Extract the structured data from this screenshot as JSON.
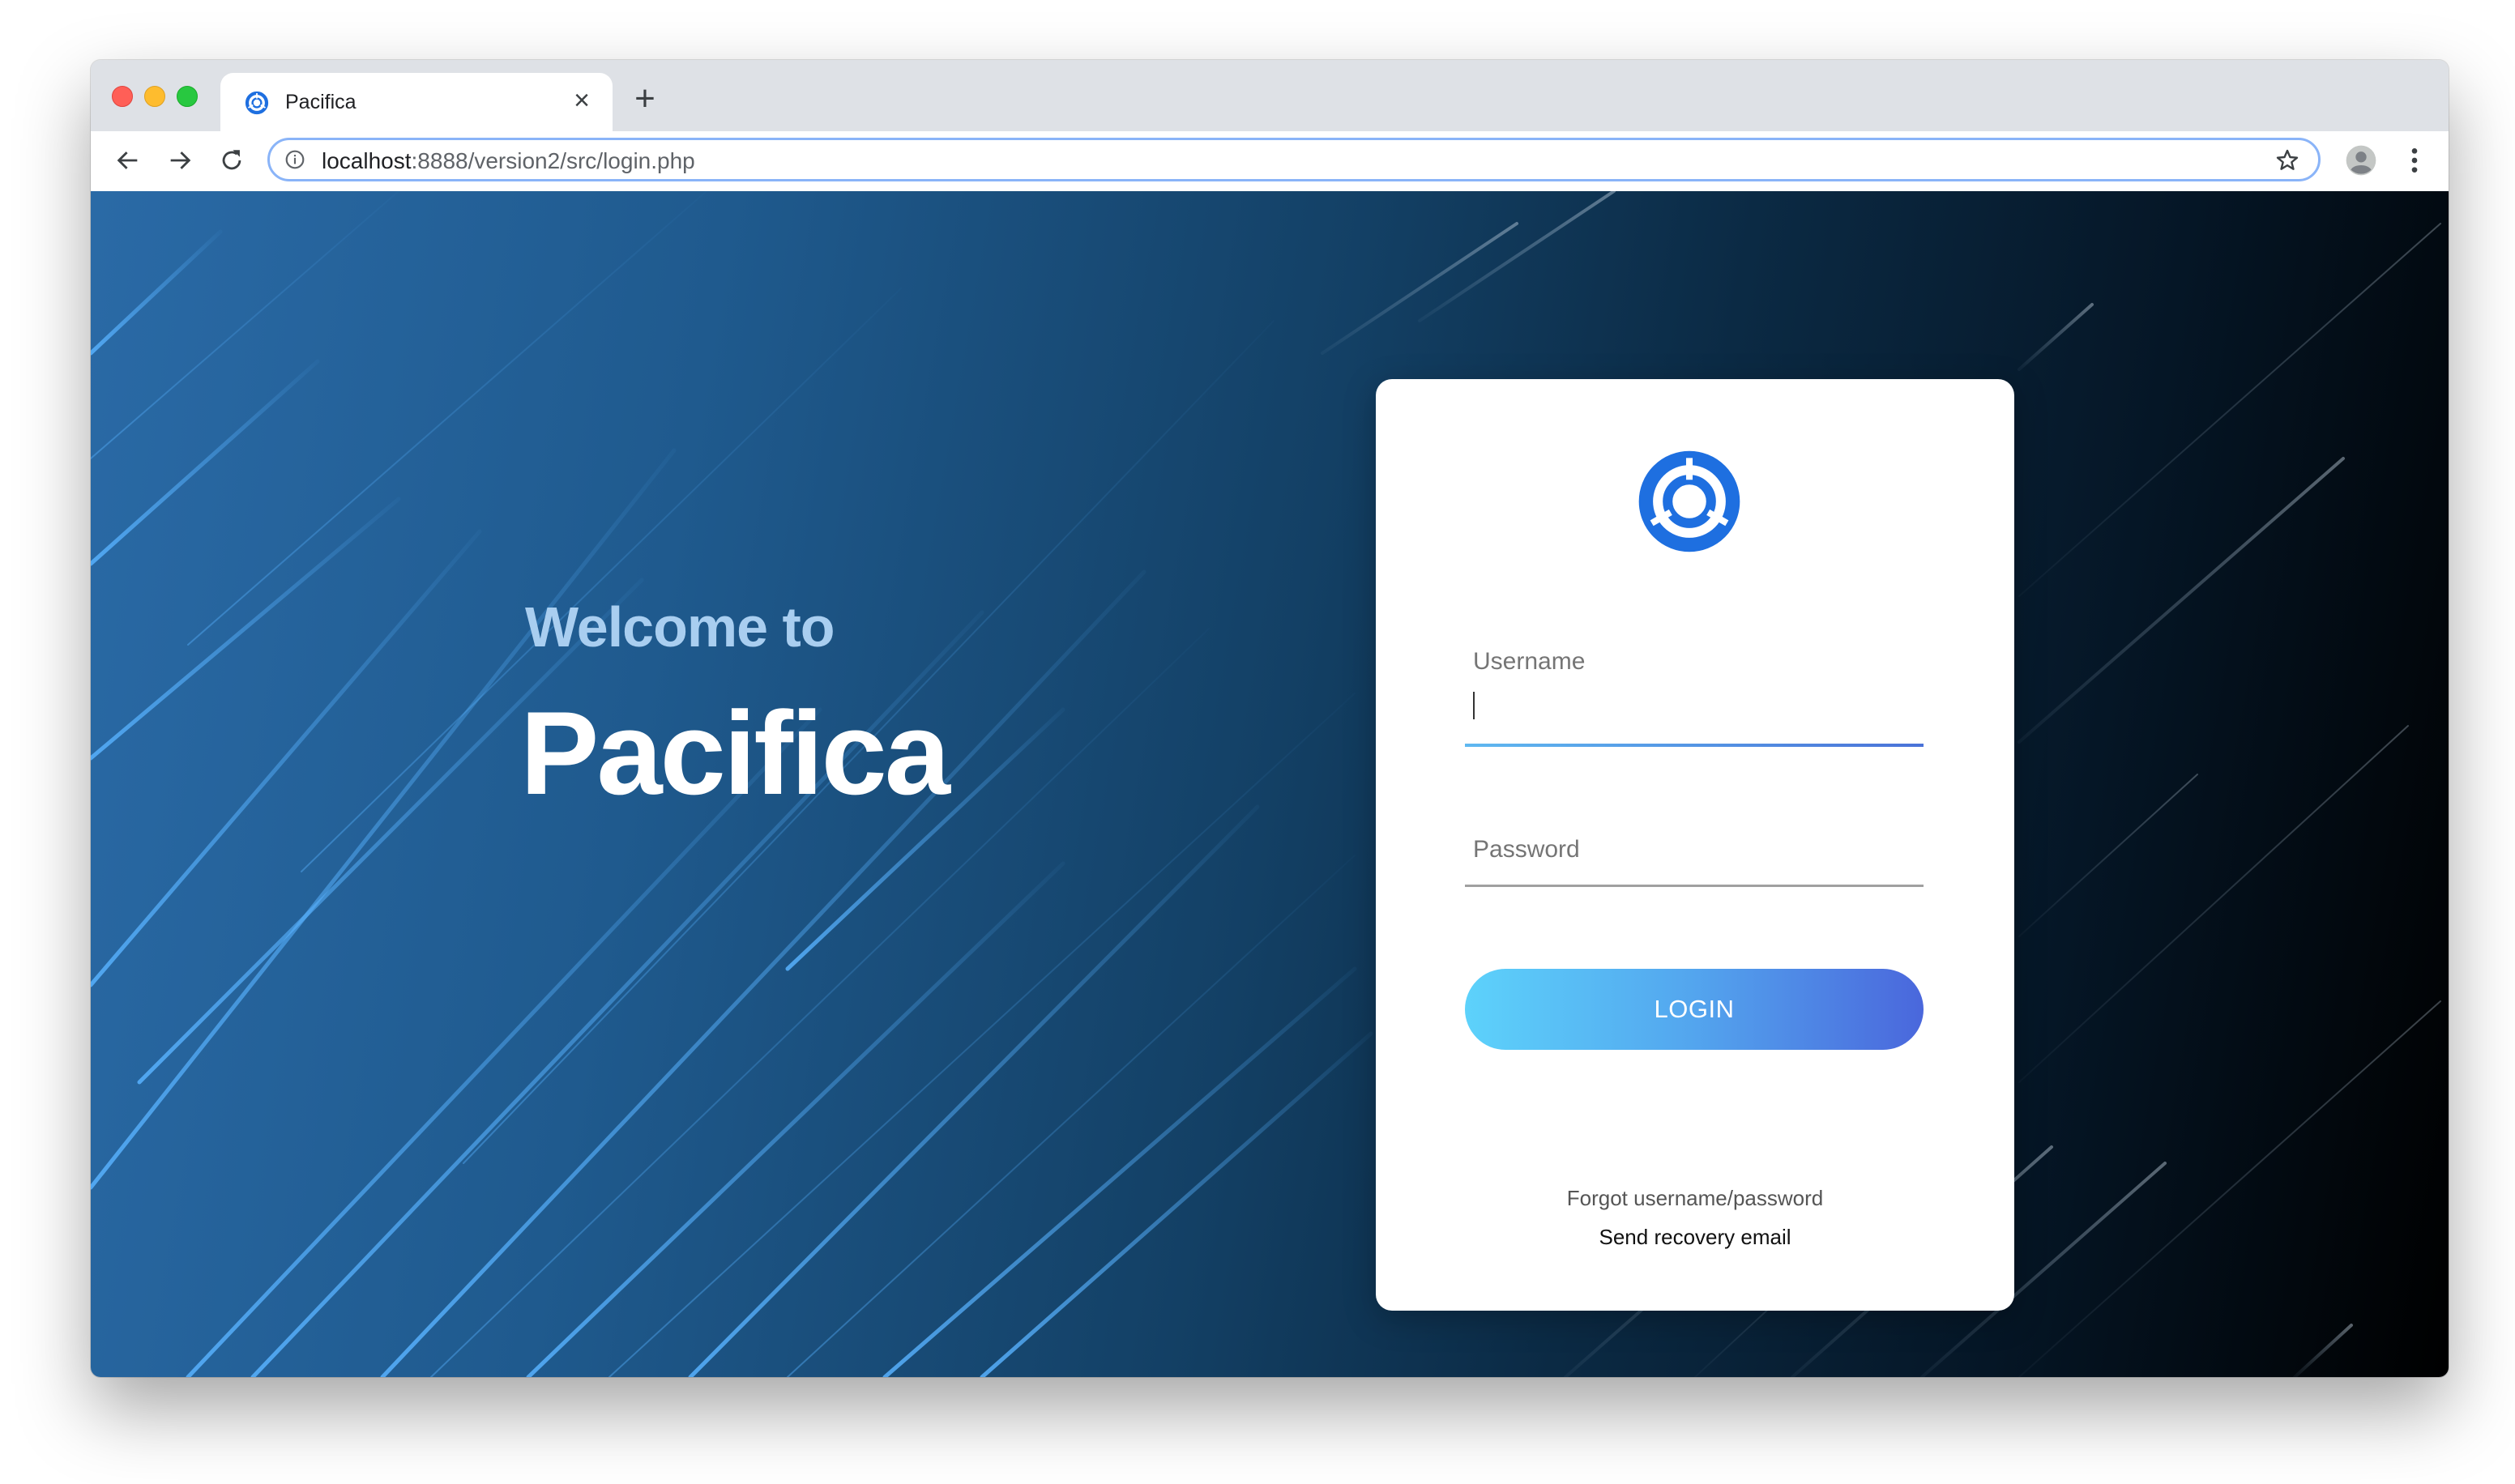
{
  "browser": {
    "tab": {
      "title": "Pacifica",
      "favicon": "pacifica-logo-icon",
      "close_icon": "×"
    },
    "new_tab_icon": "+",
    "address_bar": {
      "url_host": "localhost",
      "url_rest": ":8888/version2/src/login.php"
    },
    "icons": {
      "back": "back-arrow-icon",
      "forward": "forward-arrow-icon",
      "reload": "reload-icon",
      "info": "info-icon",
      "bookmark": "star-icon",
      "profile": "profile-icon",
      "menu": "more-vert-icon"
    }
  },
  "page": {
    "welcome_line": "Welcome to",
    "app_name": "Pacifica",
    "background_gradient": [
      "#2a6aa6",
      "#134065",
      "#000000"
    ]
  },
  "login_card": {
    "logo": "pacifica-logo-icon",
    "username_label": "Username",
    "username_value": "",
    "password_label": "Password",
    "password_value": "",
    "login_button": "LOGIN",
    "forgot_text": "Forgot username/password",
    "recovery_link": "Send recovery email",
    "colors": {
      "brand_blue": "#1e6fe0",
      "button_gradient_start": "#5dd2fb",
      "button_gradient_end": "#4a67dc",
      "active_underline": "#4a90e2"
    }
  }
}
